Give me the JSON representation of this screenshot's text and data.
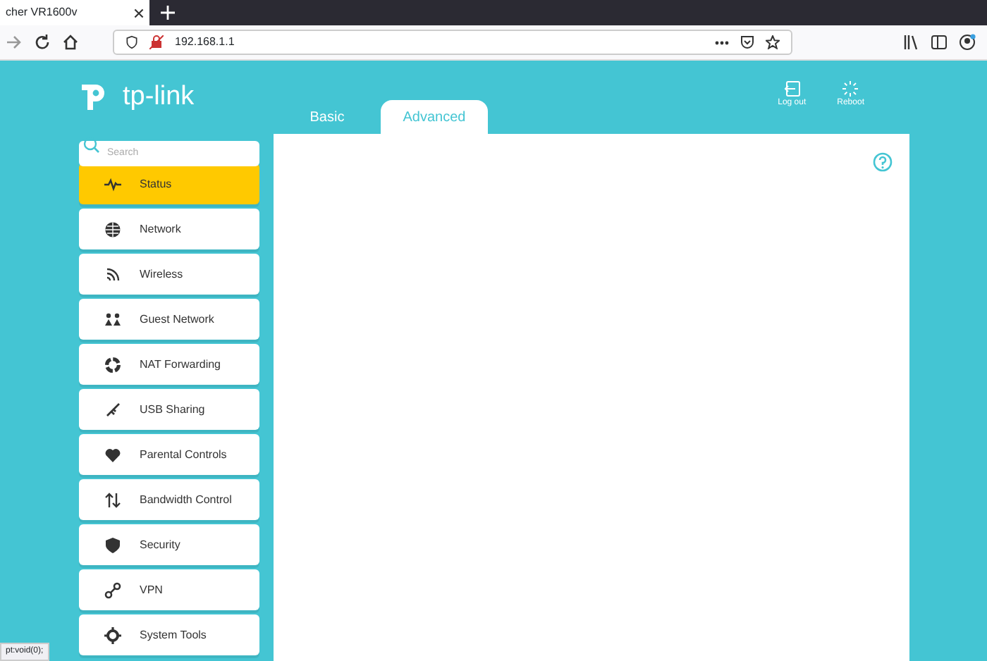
{
  "browser": {
    "tab_title": "cher VR1600v",
    "url": "192.168.1.1"
  },
  "header": {
    "logo_text": "tp-link",
    "tabs": [
      {
        "label": "Basic",
        "selected": false
      },
      {
        "label": "Advanced",
        "selected": true
      }
    ],
    "actions": [
      "Log out",
      "Reboot"
    ]
  },
  "sidebar": {
    "search": {
      "placeholder": "Search"
    },
    "items": [
      {
        "label": "Status",
        "selected": true
      },
      {
        "label": "Network",
        "selected": false
      },
      {
        "label": "Wireless",
        "selected": false
      },
      {
        "label": "Guest Network",
        "selected": false
      },
      {
        "label": "NAT Forwarding",
        "selected": false
      },
      {
        "label": "USB Sharing",
        "selected": false
      },
      {
        "label": "Parental Controls",
        "selected": false
      },
      {
        "label": "Bandwidth Control",
        "selected": false
      },
      {
        "label": "Security",
        "selected": false
      },
      {
        "label": "VPN",
        "selected": false
      },
      {
        "label": "System Tools",
        "selected": false
      }
    ]
  },
  "status_bar": "pt:void(0);"
}
